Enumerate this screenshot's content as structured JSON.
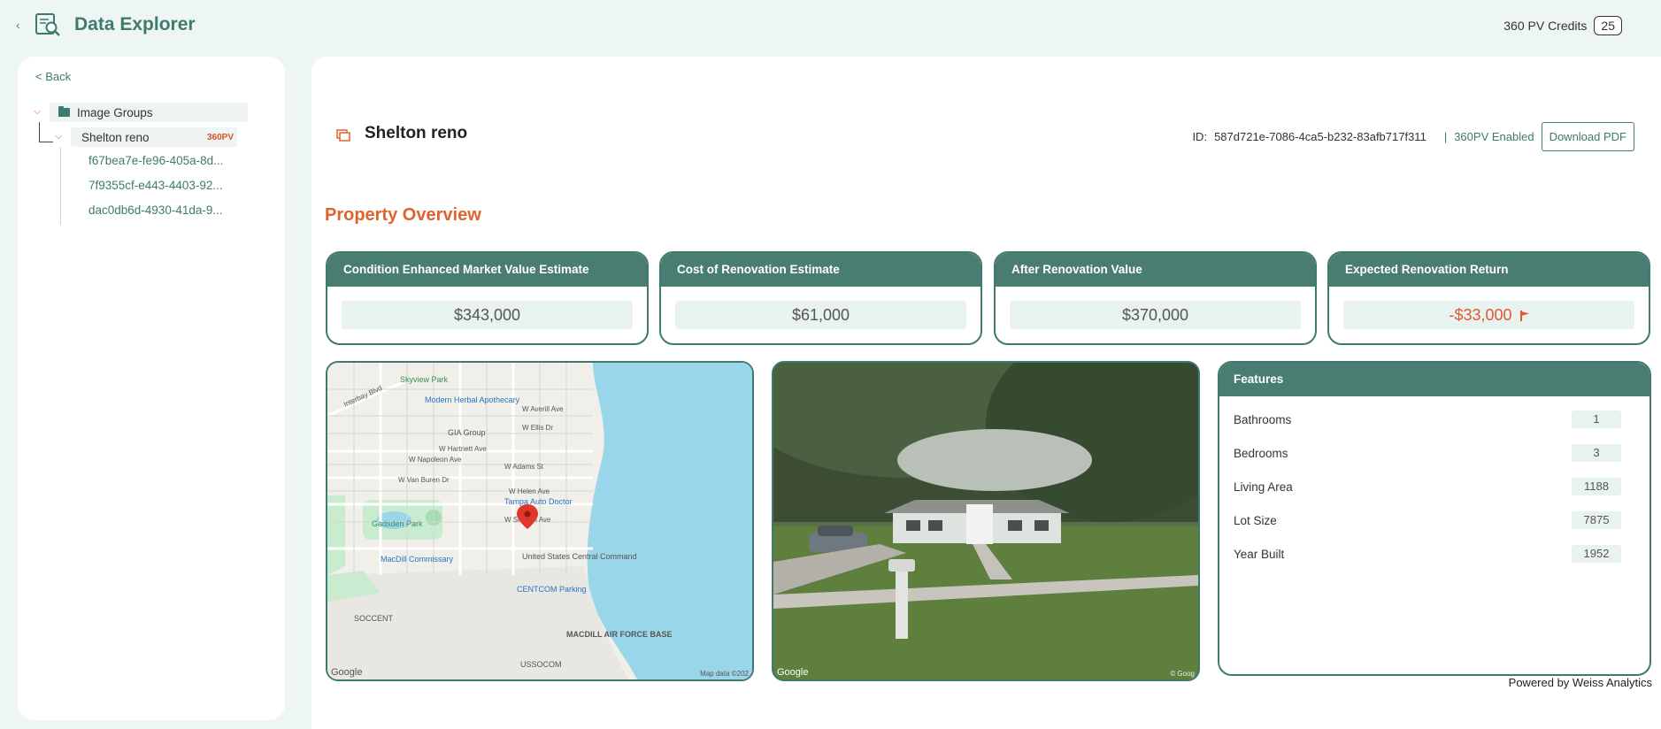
{
  "header": {
    "title": "Data Explorer",
    "credits_label": "360 PV Credits",
    "credits_count": "25"
  },
  "sidebar": {
    "back_label": "< Back",
    "root_label": "Image Groups",
    "group_label": "Shelton reno",
    "group_badge": "360PV",
    "items": [
      {
        "label": "f67bea7e-fe96-405a-8d..."
      },
      {
        "label": "7f9355cf-e443-4403-92..."
      },
      {
        "label": "dac0db6d-4930-41da-9..."
      }
    ]
  },
  "main": {
    "title": "Shelton reno",
    "id_label": "ID:",
    "id_value": "587d721e-7086-4ca5-b232-83afb717f311",
    "separator": "|",
    "enabled_label": "360PV Enabled",
    "download_label": "Download PDF",
    "section_title": "Property Overview",
    "metrics": [
      {
        "label": "Condition Enhanced Market Value Estimate",
        "value": "$343,000"
      },
      {
        "label": "Cost of Renovation Estimate",
        "value": "$61,000"
      },
      {
        "label": "After Renovation Value",
        "value": "$370,000"
      },
      {
        "label": "Expected Renovation Return",
        "value": "-$33,000"
      }
    ],
    "map": {
      "labels": [
        "Skyview Park",
        "Modern Herbal Apothecary",
        "GIA Group",
        "W Napoleon Ave",
        "W Adams St",
        "W Hartnett Ave",
        "W Van Buren Dr",
        "W Helen Ave",
        "Tampa Auto Doctor",
        "W Shelton Ave",
        "Gadsden Park",
        "MacDill Commissary",
        "United States Central Command",
        "CENTCOM Parking",
        "SOCCENT",
        "MACDILL AIR FORCE BASE",
        "USSOCOM",
        "W Averill Ave",
        "W Ellis Dr",
        "Interbay Blvd"
      ],
      "google": "Google",
      "attribution": "Map data ©202"
    },
    "photo": {
      "google": "Google",
      "attribution": "© Goog"
    },
    "features": {
      "title": "Features",
      "rows": [
        {
          "label": "Bathrooms",
          "value": "1"
        },
        {
          "label": "Bedrooms",
          "value": "3"
        },
        {
          "label": "Living Area",
          "value": "1188"
        },
        {
          "label": "Lot Size",
          "value": "7875"
        },
        {
          "label": "Year Built",
          "value": "1952"
        }
      ]
    },
    "powered_by": "Powered by Weiss Analytics"
  },
  "colors": {
    "brand_green": "#3f7a6e",
    "header_green": "#4a7d72",
    "accent_orange": "#e0622d"
  }
}
